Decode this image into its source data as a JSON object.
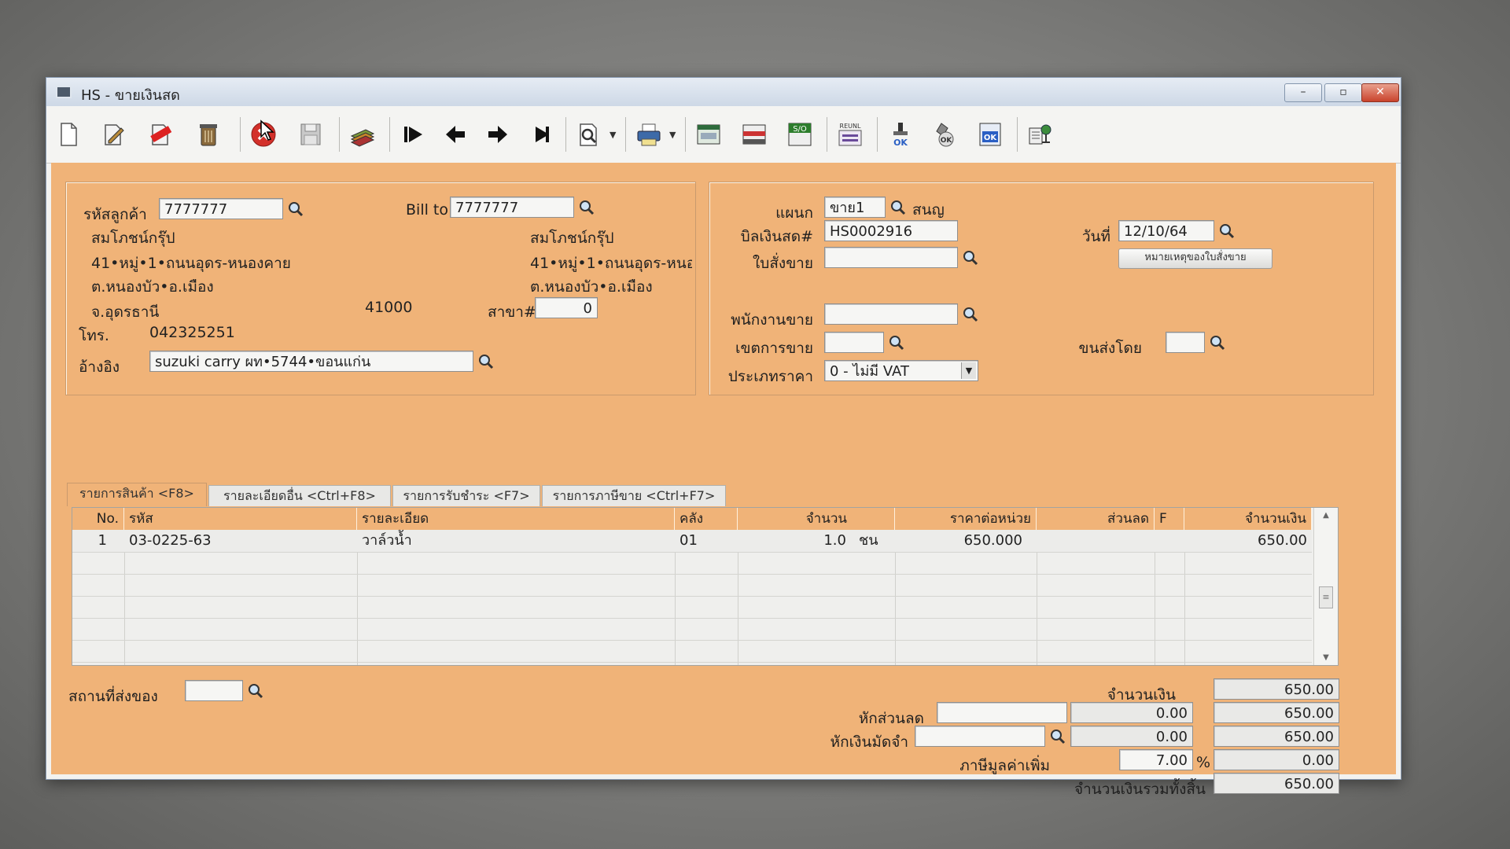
{
  "window": {
    "title": "HS - ขายเงินสด",
    "controls": {
      "minimize": "–",
      "maximize": "▫",
      "close": "✕"
    }
  },
  "toolbar": {
    "icons": [
      "new-icon",
      "edit-icon",
      "void-icon",
      "delete-icon",
      "cancel-icon",
      "save-icon",
      "books-icon",
      "first-record-icon",
      "prev-record-icon",
      "next-record-icon",
      "last-record-icon",
      "find-icon",
      "print-icon",
      "tax-invoice-icon",
      "invoice-icon",
      "so-icon",
      "refund-icon",
      "stamp-ok-icon",
      "approve-icon",
      "doc-ok-icon",
      "network-icon"
    ],
    "icon_texts": {
      "so": "S/O",
      "refund": "REUNL"
    }
  },
  "customer": {
    "code_label": "รหัสลูกค้า",
    "code": "7777777",
    "billto_label": "Bill to",
    "billto": "7777777",
    "name": "สมโภชน์กรุ๊ป",
    "addr1": "41•หมู่•1•ถนนอุดร-หนองคาย",
    "addr2": "ต.หนองบัว•อ.เมือง",
    "addr3": "จ.อุดรธานี",
    "zip": "41000",
    "bill_name": "สมโภชน์กรุ๊ป",
    "bill_addr1": "41•หมู่•1•ถนนอุดร-หนอ",
    "bill_addr2": "ต.หนองบัว•อ.เมือง",
    "branch_label": "สาขา#",
    "branch": "0",
    "phone_label": "โทร.",
    "phone": "042325251",
    "ref_label": "อ้างอิง",
    "ref": "suzuki carry ผท•5744•ขอนแก่น"
  },
  "doc": {
    "dept_label": "แผนก",
    "dept": "ขาย1",
    "dept_name": "สนญ",
    "bill_label": "บิลเงินสด#",
    "bill_no": "HS0002916",
    "date_label": "วันที่",
    "date": "12/10/64",
    "so_label": "ใบสั่งขาย",
    "so": "",
    "so_note_button": "หมายเหตุของใบสั่งขาย",
    "salesman_label": "พนักงานขาย",
    "salesman": "",
    "area_label": "เขตการขาย",
    "area": "",
    "shipby_label": "ขนส่งโดย",
    "shipby": "",
    "pricetype_label": "ประเภทราคา",
    "pricetype": "0 - ไม่มี VAT"
  },
  "tabs": [
    "รายการสินค้า <F8>",
    "รายละเอียดอื่น <Ctrl+F8>",
    "รายการรับชำระ <F7>",
    "รายการภาษีขาย <Ctrl+F7>"
  ],
  "grid": {
    "headers": [
      "No.",
      "รหัส",
      "รายละเอียด",
      "คลัง",
      "จำนวน",
      "ราคาต่อหน่วย",
      "ส่วนลด",
      "F",
      "จำนวนเงิน"
    ],
    "rows": [
      {
        "no": "1",
        "code": "03-0225-63",
        "desc": "วาล์วน้ำ",
        "wh": "01",
        "qty": "1.0",
        "unit": "ชน",
        "price": "650.000",
        "disc": "",
        "f": "",
        "amount": "650.00"
      }
    ],
    "scroll": {
      "up": "▲",
      "down": "▼",
      "thumb": "≡"
    }
  },
  "footer": {
    "shipto_label": "สถานที่ส่งของ",
    "shipto": "",
    "amount_label": "จำนวนเงิน",
    "amount": "650.00",
    "discount_label": "หักส่วนลด",
    "discount_input": "",
    "discount_value": "0.00",
    "after_discount": "650.00",
    "deposit_label": "หักเงินมัดจำ",
    "deposit_input": "",
    "deposit_value": "0.00",
    "after_deposit": "650.00",
    "vat_label": "ภาษีมูลค่าเพิ่ม",
    "vat_rate": "7.00",
    "vat_pct": "%",
    "vat_amount": "0.00",
    "total_label": "จำนวนเงินรวมทั้งสิ้น",
    "total": "650.00"
  }
}
